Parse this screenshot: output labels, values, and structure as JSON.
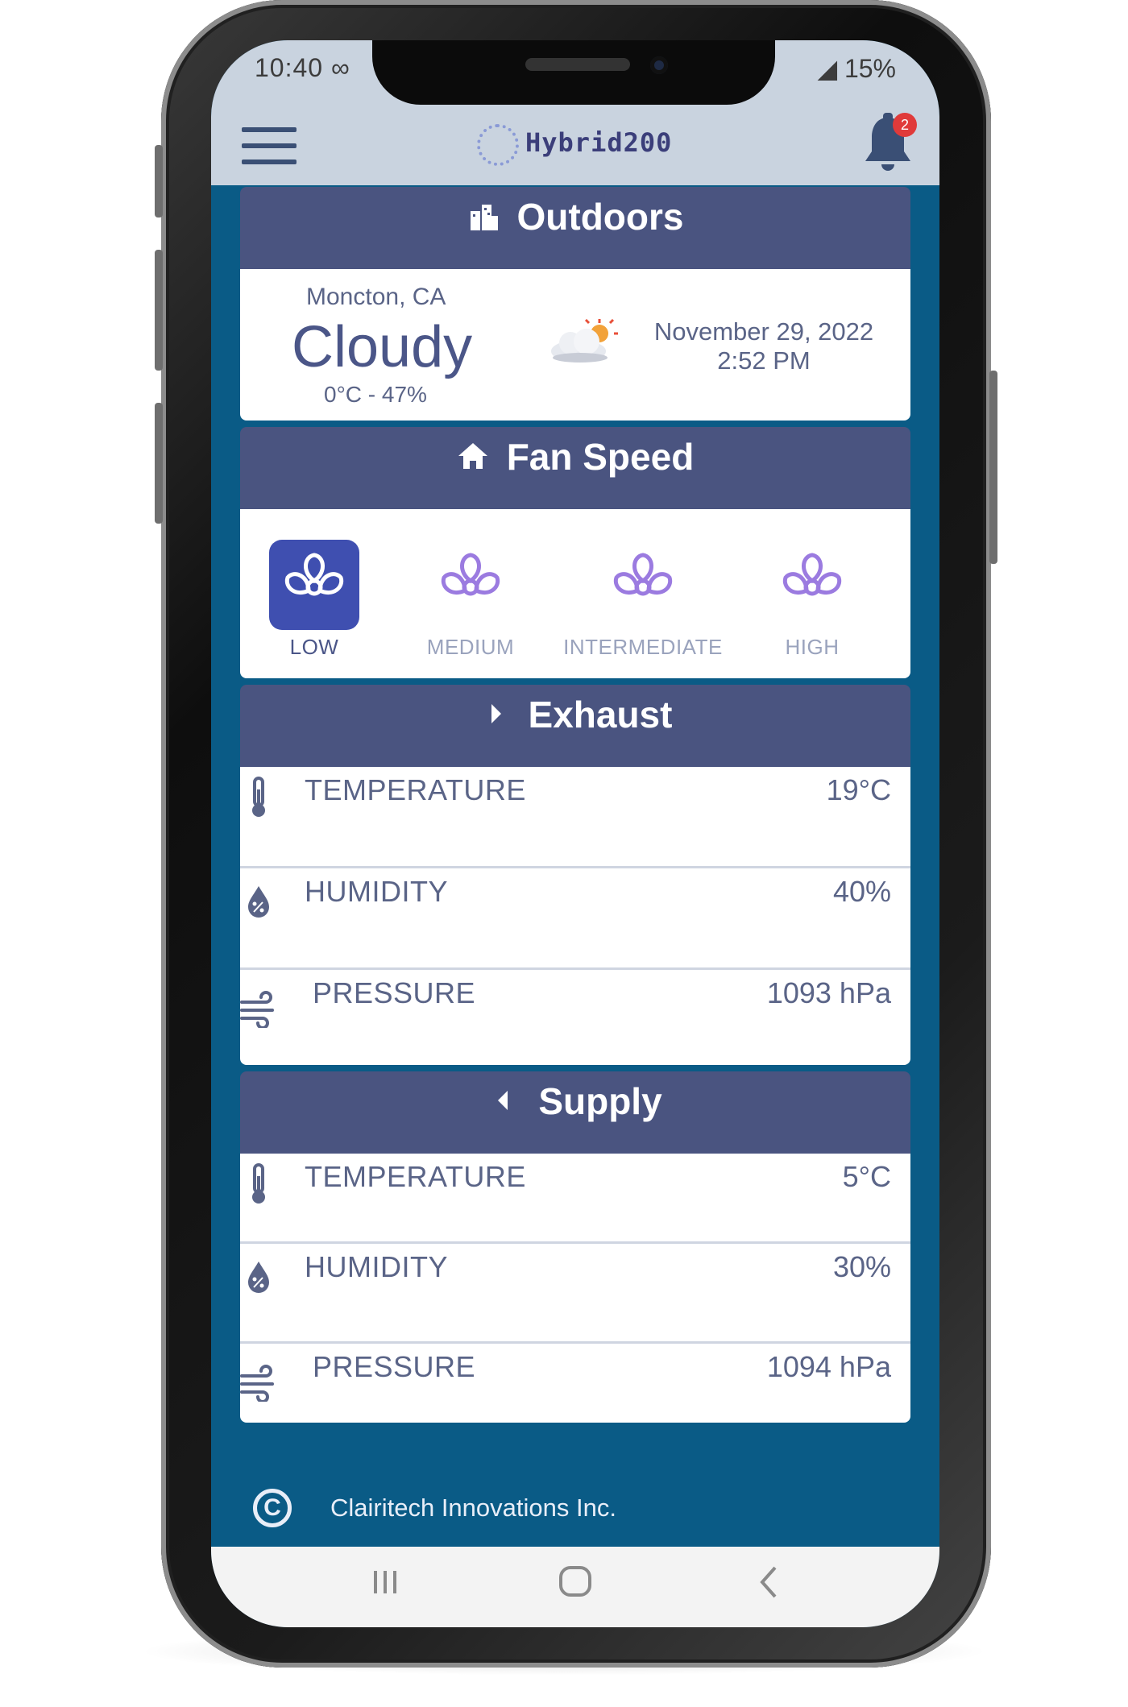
{
  "status_bar": {
    "time": "10:40 ∞",
    "battery": "15%"
  },
  "app": {
    "name": "Hybrid200",
    "notification_count": "2"
  },
  "outdoors": {
    "title": "Outdoors",
    "location": "Moncton, CA",
    "condition": "Cloudy",
    "temp_humidity": "0°C - 47%",
    "date": "November 29, 2022",
    "time": "2:52 PM",
    "weather_icon": "cloud-sun-icon"
  },
  "fan_speed": {
    "title": "Fan Speed",
    "options": [
      {
        "label": "LOW",
        "selected": true
      },
      {
        "label": "MEDIUM",
        "selected": false
      },
      {
        "label": "INTERMEDIATE",
        "selected": false
      },
      {
        "label": "HIGH",
        "selected": false
      }
    ]
  },
  "exhaust": {
    "title": "Exhaust",
    "metrics": [
      {
        "label": "TEMPERATURE",
        "value": "19°C",
        "icon": "thermometer-icon"
      },
      {
        "label": "HUMIDITY",
        "value": "40%",
        "icon": "humidity-drop-icon"
      },
      {
        "label": "PRESSURE",
        "value": "1093 hPa",
        "icon": "wind-icon"
      }
    ]
  },
  "supply": {
    "title": "Supply",
    "metrics": [
      {
        "label": "TEMPERATURE",
        "value": "5°C",
        "icon": "thermometer-icon"
      },
      {
        "label": "HUMIDITY",
        "value": "30%",
        "icon": "humidity-drop-icon"
      },
      {
        "label": "PRESSURE",
        "value": "1094 hPa",
        "icon": "wind-icon"
      }
    ]
  },
  "footer": {
    "text": "Clairitech Innovations Inc."
  },
  "colors": {
    "header_bg": "#4a5480",
    "page_bg": "#0a5b86",
    "app_bar_bg": "#c9d3df",
    "fan_active": "#3f4fb0",
    "fan_icon": "#9b7be0"
  }
}
